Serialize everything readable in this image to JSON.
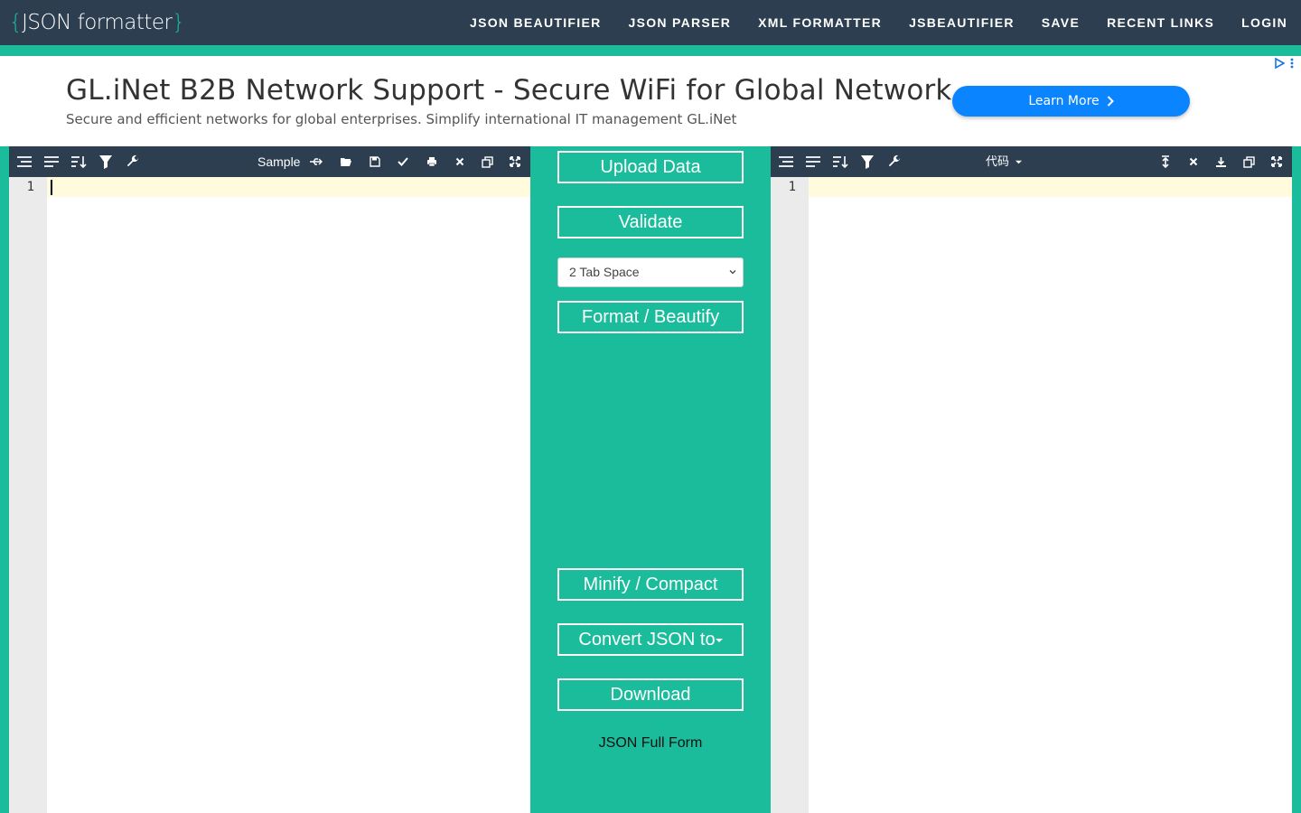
{
  "brand": {
    "open_brace": "{",
    "name": "JSON formatter",
    "close_brace": "}"
  },
  "nav": {
    "items": [
      "JSON BEAUTIFIER",
      "JSON PARSER",
      "XML FORMATTER",
      "JSBEAUTIFIER",
      "SAVE",
      "RECENT LINKS",
      "LOGIN"
    ]
  },
  "ad": {
    "headline": "GL.iNet B2B Network Support - Secure WiFi for Global Network",
    "subtext": "Secure and efficient networks for global enterprises. Simplify international IT management GL.iNet",
    "cta": "Learn More",
    "cta_color": "#0a84ff"
  },
  "left_editor": {
    "sample_label": "Sample",
    "line_numbers": [
      "1"
    ]
  },
  "right_editor": {
    "code_mode": "代码",
    "line_numbers": [
      "1"
    ]
  },
  "actions": {
    "upload": "Upload Data",
    "validate": "Validate",
    "indent_selected": "2 Tab Space",
    "format": "Format / Beautify",
    "minify": "Minify / Compact",
    "convert": "Convert JSON to",
    "download": "Download",
    "full_form": "JSON Full Form"
  },
  "colors": {
    "nav_bg": "#2c3e50",
    "accent": "#1abc9c",
    "active_line": "#fffbdc"
  }
}
